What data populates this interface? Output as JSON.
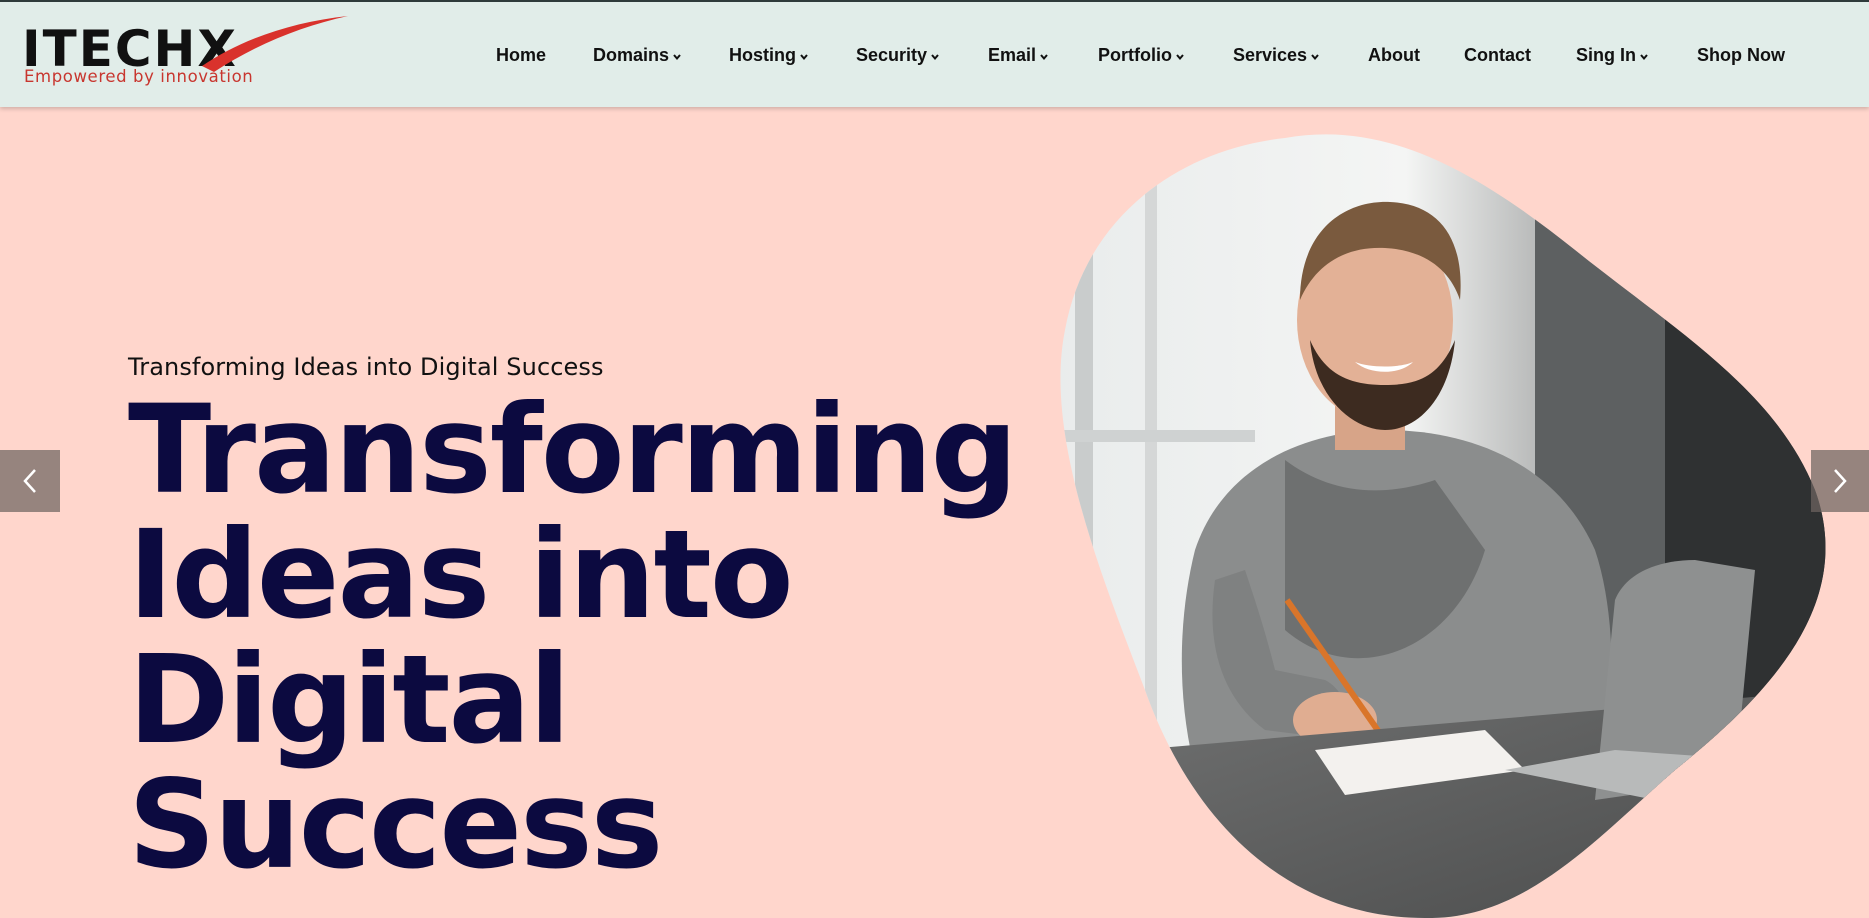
{
  "logo": {
    "brand": "ITECHX",
    "tagline": "Empowered by innovation"
  },
  "nav": {
    "items": [
      {
        "label": "Home",
        "dropdown": false
      },
      {
        "label": "Domains",
        "dropdown": true
      },
      {
        "label": "Hosting",
        "dropdown": true
      },
      {
        "label": "Security",
        "dropdown": true
      },
      {
        "label": "Email",
        "dropdown": true
      },
      {
        "label": "Portfolio",
        "dropdown": true
      },
      {
        "label": "Services",
        "dropdown": true
      },
      {
        "label": "About",
        "dropdown": false
      },
      {
        "label": "Contact",
        "dropdown": false
      },
      {
        "label": "Sing In",
        "dropdown": true
      },
      {
        "label": "Shop Now",
        "dropdown": false
      }
    ]
  },
  "hero": {
    "subtitle": "Transforming Ideas into Digital Success",
    "title_lines": [
      "Transforming",
      "Ideas into",
      "Digital Success"
    ]
  },
  "slider": {
    "prev_icon": "chevron-left-icon",
    "next_icon": "chevron-right-icon"
  },
  "colors": {
    "header_bg": "#e1ede9",
    "hero_bg": "#ffd6cc",
    "title_color": "#0c0a40",
    "logo_red": "#c8362f"
  }
}
